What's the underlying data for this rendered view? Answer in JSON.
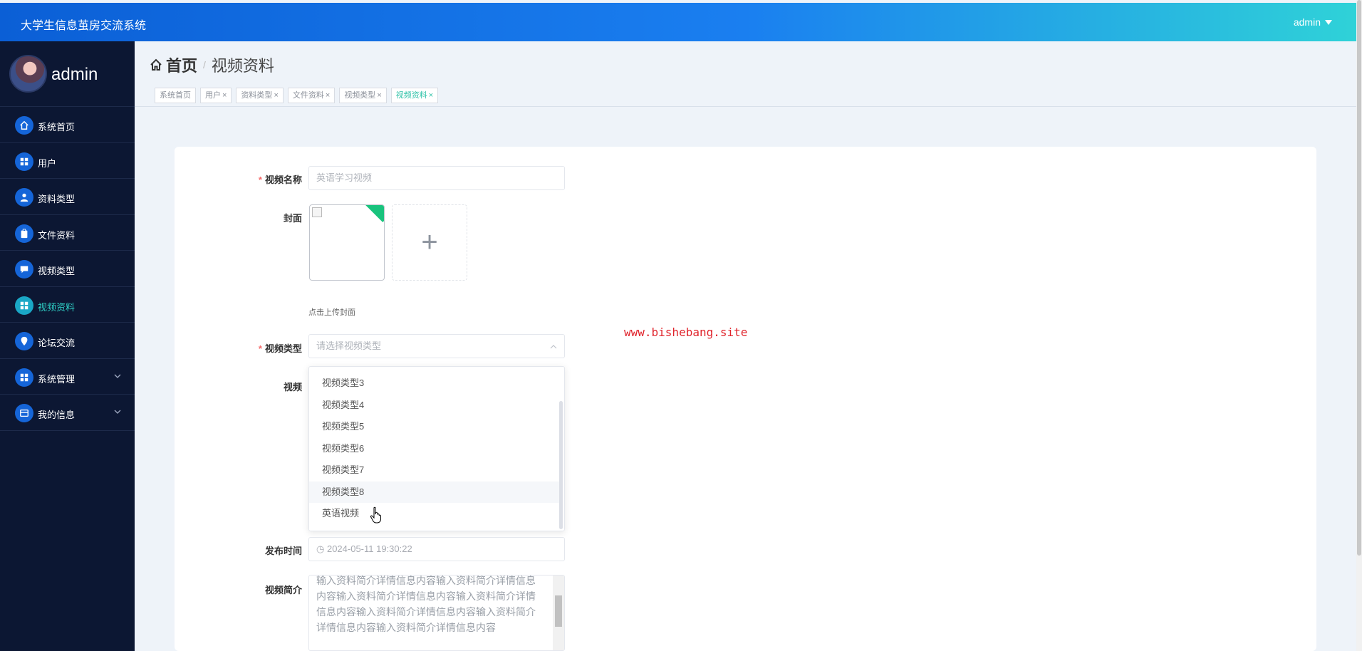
{
  "app": {
    "title": "大学生信息茧房交流系统",
    "user": "admin"
  },
  "sidebar": {
    "profile_name": "admin",
    "items": [
      {
        "label": "系统首页",
        "icon": "home-icon"
      },
      {
        "label": "用户",
        "icon": "grid-icon"
      },
      {
        "label": "资料类型",
        "icon": "person-icon"
      },
      {
        "label": "文件资料",
        "icon": "clipboard-icon"
      },
      {
        "label": "视频类型",
        "icon": "chat-icon"
      },
      {
        "label": "视频资料",
        "icon": "grid-icon",
        "active": true
      },
      {
        "label": "论坛交流",
        "icon": "location-icon"
      },
      {
        "label": "系统管理",
        "icon": "grid-icon",
        "expandable": true
      },
      {
        "label": "我的信息",
        "icon": "card-icon",
        "expandable": true
      }
    ]
  },
  "breadcrumb": {
    "home": "首页",
    "current": "视频资料"
  },
  "tabs": [
    {
      "label": "系统首页",
      "closable": false
    },
    {
      "label": "用户",
      "closable": true
    },
    {
      "label": "资料类型",
      "closable": true
    },
    {
      "label": "文件资料",
      "closable": true
    },
    {
      "label": "视频类型",
      "closable": true
    },
    {
      "label": "视频资料",
      "closable": true,
      "active": true
    }
  ],
  "form": {
    "name_label": "视频名称",
    "name_placeholder": "英语学习视频",
    "cover_label": "封面",
    "cover_hint": "点击上传封面",
    "type_label": "视频类型",
    "type_placeholder": "请选择视频类型",
    "video_label": "视频",
    "date_label": "发布时间",
    "date_value": "2024-05-11 19:30:22",
    "intro_label": "视频简介",
    "intro_text": "输入资料简介详情信息内容输入资料简介详情信息内容输入资料简介详情信息内容输入资料简介详情信息内容输入资料简介详情信息内容输入资料简介详情信息内容输入资料简介详情信息内容"
  },
  "dropdown": {
    "options": [
      "视频类型3",
      "视频类型4",
      "视频类型5",
      "视频类型6",
      "视频类型7",
      "视频类型8",
      "英语视频"
    ],
    "hovered": "视频类型8"
  },
  "watermark": "www.bishebang.site"
}
